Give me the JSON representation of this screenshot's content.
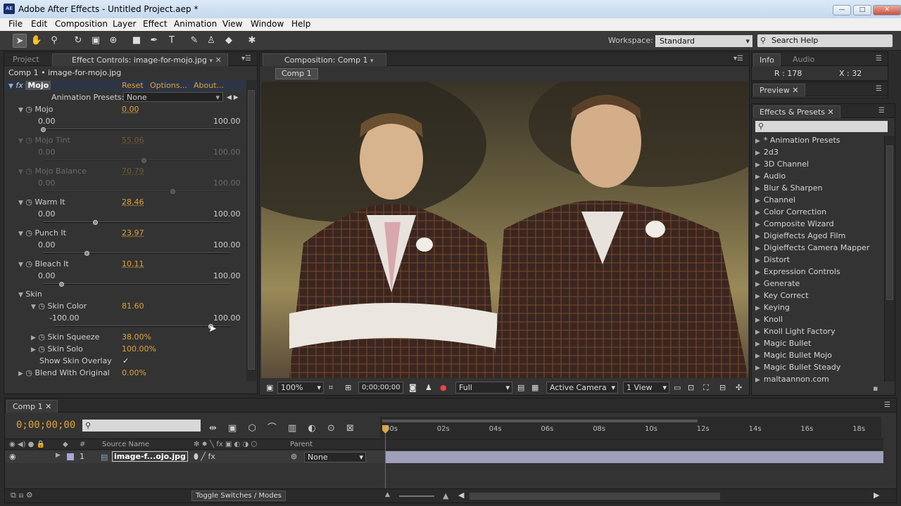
{
  "window": {
    "title": "Adobe After Effects - Untitled Project.aep *",
    "logo": "AE",
    "controls": [
      "minimize",
      "maximize",
      "close"
    ]
  },
  "menu": [
    "File",
    "Edit",
    "Composition",
    "Layer",
    "Effect",
    "Animation",
    "View",
    "Window",
    "Help"
  ],
  "toolbar": {
    "tools": [
      "selection-tool",
      "hand-tool",
      "zoom-tool",
      "rotation-tool",
      "camera-tool",
      "pan-behind-tool",
      "rectangle-tool",
      "pen-tool",
      "type-tool",
      "brush-tool",
      "clone-stamp-tool",
      "eraser-tool",
      "puppet-pin-tool"
    ],
    "workspace_label": "Workspace:",
    "workspace_value": "Standard",
    "search_placeholder": "Search Help"
  },
  "left_panel": {
    "tabs": [
      "Project",
      "Effect Controls: image-for-mojo.jpg"
    ],
    "breadcrumb": "Comp 1 • image-for-mojo.jpg",
    "effect_name": "Mojo",
    "reset": "Reset",
    "options": "Options...",
    "about": "About...",
    "presets_label": "Animation Presets:",
    "presets_value": "None",
    "params": [
      {
        "label": "Mojo",
        "value": "0.00",
        "min": "0.00",
        "max": "100.00",
        "level": 0.0,
        "enabled": true
      },
      {
        "label": "Mojo Tint",
        "value": "55.06",
        "min": "0.00",
        "max": "100.00",
        "level": 0.5506,
        "enabled": false
      },
      {
        "label": "Mojo Balance",
        "value": "70.79",
        "min": "0.00",
        "max": "100.00",
        "level": 0.7079,
        "enabled": false
      },
      {
        "label": "Warm It",
        "value": "28.46",
        "min": "0.00",
        "max": "100.00",
        "level": 0.2846,
        "enabled": true
      },
      {
        "label": "Punch It",
        "value": "23.97",
        "min": "0.00",
        "max": "100.00",
        "level": 0.2397,
        "enabled": true
      },
      {
        "label": "Bleach It",
        "value": "10.11",
        "min": "0.00",
        "max": "100.00",
        "level": 0.1011,
        "enabled": true
      }
    ],
    "skin": {
      "label": "Skin",
      "color_label": "Skin Color",
      "color_value": "81.60",
      "min": "-100.00",
      "max": "100.00",
      "level": 0.908,
      "squeeze_label": "Skin Squeeze",
      "squeeze_value": "38.00%",
      "solo_label": "Skin Solo",
      "solo_value": "100.00%",
      "overlay_label": "Show Skin Overlay",
      "overlay_checked": "✓"
    },
    "blend": {
      "label": "Blend With Original",
      "value": "0.00%"
    }
  },
  "comp_panel": {
    "tab": "Composition: Comp 1",
    "crumb": "Comp 1",
    "zoom": "100%",
    "timecode": "0;00;00;00",
    "resolution": "Full",
    "camera": "Active Camera",
    "views": "1 View"
  },
  "info_panel": {
    "tabs": [
      "Info",
      "Audio"
    ],
    "r": "R : 178",
    "x": "X : 32"
  },
  "preview_panel": {
    "tab": "Preview"
  },
  "effects_panel": {
    "tab": "Effects & Presets",
    "items": [
      "* Animation Presets",
      "2d3",
      "3D Channel",
      "Audio",
      "Blur & Sharpen",
      "Channel",
      "Color Correction",
      "Composite Wizard",
      "Digieffects Aged Film",
      "Digieffects Camera Mapper",
      "Distort",
      "Expression Controls",
      "Generate",
      "Key Correct",
      "Keying",
      "Knoll",
      "Knoll Light Factory",
      "Magic Bullet",
      "Magic Bullet Mojo",
      "Magic Bullet Steady",
      "maltaannon.com"
    ]
  },
  "timeline": {
    "tab": "Comp 1",
    "time": "0;00;00;00",
    "col_source": "Source Name",
    "col_parent": "Parent",
    "col_num": "#",
    "layer_num": "1",
    "layer_name": "image-f...ojo.jpg",
    "parent_value": "None",
    "ruler": [
      "00s",
      "02s",
      "04s",
      "06s",
      "08s",
      "10s",
      "12s",
      "14s",
      "16s",
      "18s"
    ],
    "toggle": "Toggle Switches / Modes"
  }
}
